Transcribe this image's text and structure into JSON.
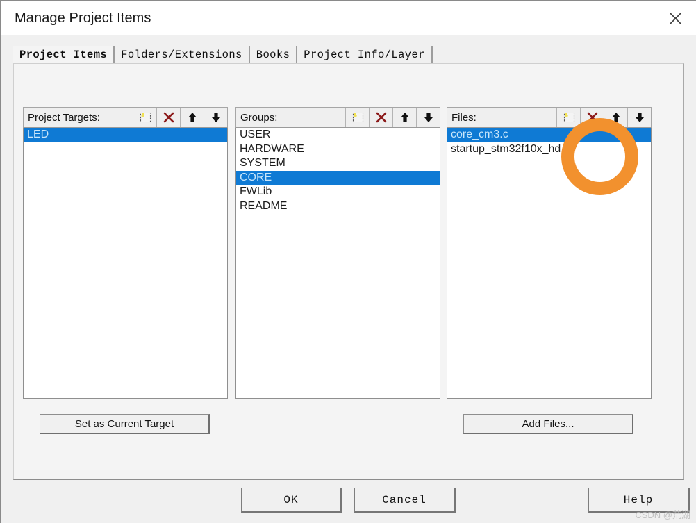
{
  "window": {
    "title": "Manage Project Items",
    "close_icon": "close-icon"
  },
  "tabs": [
    {
      "label": "Project Items",
      "active": true
    },
    {
      "label": "Folders/Extensions",
      "active": false
    },
    {
      "label": "Books",
      "active": false
    },
    {
      "label": "Project Info/Layer",
      "active": false
    }
  ],
  "columns": {
    "targets": {
      "label": "Project Targets:",
      "items": [
        {
          "text": "LED",
          "selected": true
        }
      ],
      "toolbar": [
        {
          "icon": "new-item-icon",
          "title": "New (Insert)"
        },
        {
          "icon": "delete-icon",
          "title": "Remove Item"
        },
        {
          "icon": "move-up-icon",
          "title": "Move Up"
        },
        {
          "icon": "move-down-icon",
          "title": "Move Down"
        }
      ],
      "button": "Set as Current Target"
    },
    "groups": {
      "label": "Groups:",
      "items": [
        {
          "text": "USER",
          "selected": false
        },
        {
          "text": "HARDWARE",
          "selected": false
        },
        {
          "text": "SYSTEM",
          "selected": false
        },
        {
          "text": "CORE",
          "selected": true
        },
        {
          "text": "FWLib",
          "selected": false
        },
        {
          "text": "README",
          "selected": false
        }
      ],
      "toolbar": [
        {
          "icon": "new-item-icon",
          "title": "New (Insert)"
        },
        {
          "icon": "delete-icon",
          "title": "Remove Item"
        },
        {
          "icon": "move-up-icon",
          "title": "Move Up"
        },
        {
          "icon": "move-down-icon",
          "title": "Move Down"
        }
      ]
    },
    "files": {
      "label": "Files:",
      "items": [
        {
          "text": "core_cm3.c",
          "selected": true
        },
        {
          "text": "startup_stm32f10x_hd.s",
          "selected": false
        }
      ],
      "toolbar": [
        {
          "icon": "new-item-icon",
          "title": "New (Insert)"
        },
        {
          "icon": "delete-icon",
          "title": "Remove Item"
        },
        {
          "icon": "move-up-icon",
          "title": "Move Up"
        },
        {
          "icon": "move-down-icon",
          "title": "Move Down"
        }
      ],
      "button": "Add Files..."
    }
  },
  "footer": {
    "ok": "OK",
    "cancel": "Cancel",
    "help": "Help"
  },
  "annotation": {
    "shape": "ring",
    "color": "#f2912e",
    "target": "files-delete-button"
  },
  "watermark": "CSDN @荒湖",
  "colors": {
    "selection_blue": "#0f7ad4",
    "selection_text": "#c9e6fa",
    "dialog_bg": "#f0f0f0",
    "panel_bg": "#f4f4f4",
    "delete_red": "#8c1a1a",
    "annotation_orange": "#f2912e"
  }
}
